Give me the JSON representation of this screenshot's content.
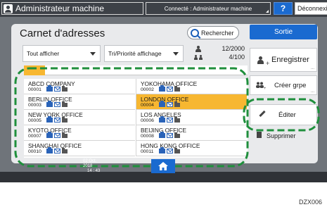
{
  "header": {
    "title": "Administrateur machine",
    "connection": "Connecté : Administrateur machine",
    "help_label": "?",
    "logout_label": "Déconnexion"
  },
  "panel": {
    "title": "Carnet d'adresses",
    "search_label": "Rechercher",
    "exit_label": "Sortie"
  },
  "filters": {
    "display_all": "Tout afficher",
    "sort_priority": "Tri/Priorité affichage",
    "count_users": "12/2000",
    "count_groups": "4/100"
  },
  "entries": [
    {
      "name": "ABCD COMPANY",
      "number": "00001"
    },
    {
      "name": "YOKOHAMA OFFICE",
      "number": "00002"
    },
    {
      "name": "BERLIN OFFICE",
      "number": "00003"
    },
    {
      "name": "LONDON OFFICE",
      "number": "00004",
      "selected": true
    },
    {
      "name": "NEW YORK OFFICE",
      "number": "00005"
    },
    {
      "name": "LOS ANGELES",
      "number": "00006"
    },
    {
      "name": "KYOTO OFFICE",
      "number": "00007"
    },
    {
      "name": "BEIJING OFFICE",
      "number": "00008"
    },
    {
      "name": "SHANGHAI OFFICE",
      "number": "00010"
    },
    {
      "name": "HONG KONG OFFICE",
      "number": "00011"
    }
  ],
  "actions": {
    "register_label": "Enregistrer",
    "create_group_label": "Créer grpe",
    "edit_label": "Éditer",
    "delete_label": "Supprimer",
    "more_dots": "..."
  },
  "footer": {
    "date": "02 Oct. 2018",
    "time": "14 : 43"
  },
  "figure_ref": "DZX006",
  "colors": {
    "accent_blue": "#1a6ad0",
    "selection_yellow": "#f7b731",
    "highlight_green": "#1f8f3c"
  }
}
